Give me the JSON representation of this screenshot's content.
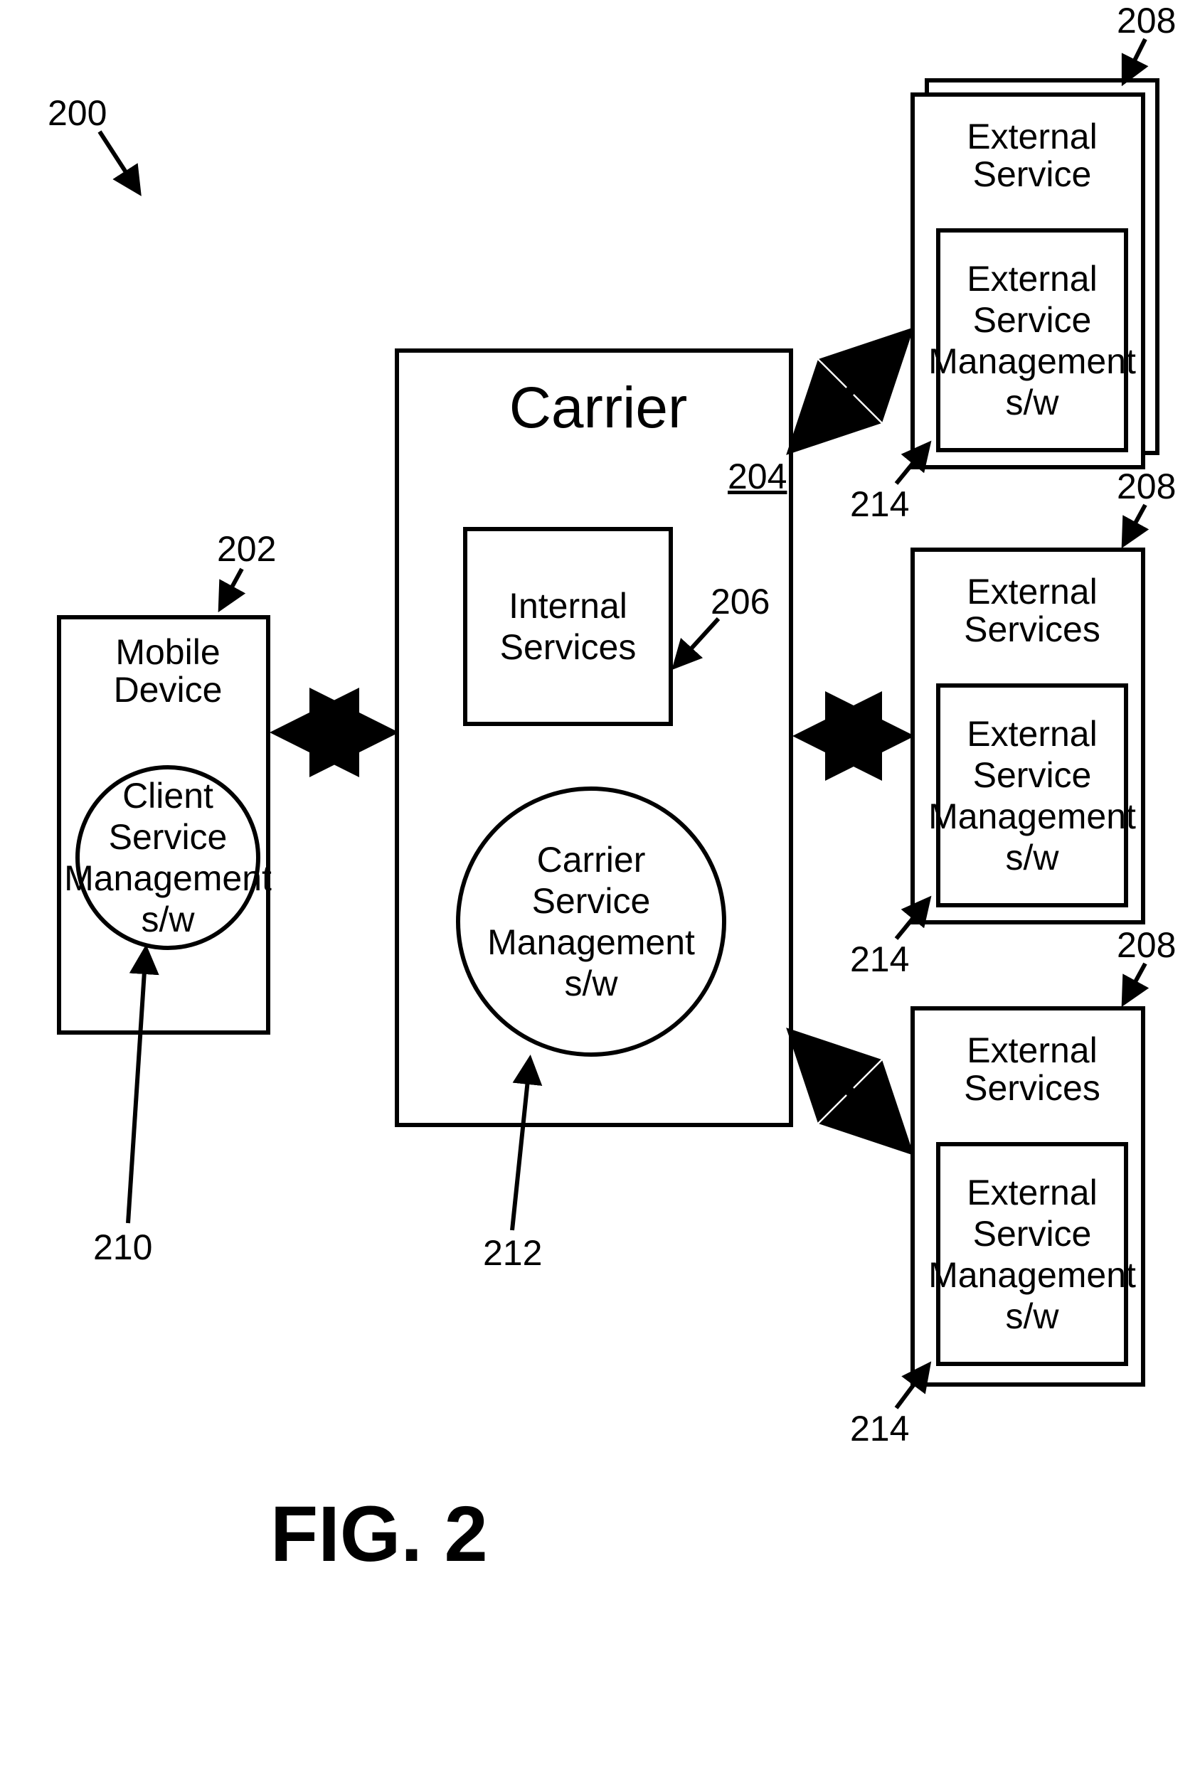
{
  "figure_label": "FIG. 2",
  "refs": {
    "system": "200",
    "mobile_device": "202",
    "carrier": "204",
    "internal_services": "206",
    "ext_a": "208",
    "ext_b": "208",
    "ext_c": "208",
    "client_sw": "210",
    "carrier_sw": "212",
    "ext_sw_a": "214",
    "ext_sw_b": "214",
    "ext_sw_c": "214"
  },
  "mobile_device": {
    "title": "Mobile Device",
    "client_sw": "Client\nService\nManagement\ns/w"
  },
  "carrier": {
    "title": "Carrier",
    "internal_services": "Internal\nServices",
    "carrier_sw": "Carrier\nService\nManagement\ns/w"
  },
  "external": {
    "a": {
      "title": "External\nService",
      "sw": "External\nService\nManagement\ns/w"
    },
    "b": {
      "title": "External\nServices",
      "sw": "External\nService\nManagement\ns/w"
    },
    "c": {
      "title": "External\nServices",
      "sw": "External\nService\nManagement\ns/w"
    }
  },
  "chart_data": {
    "type": "diagram",
    "nodes": [
      {
        "id": "mobile_device",
        "label": "Mobile Device",
        "ref": "202",
        "contains": [
          {
            "id": "client_sw",
            "label": "Client Service Management s/w",
            "ref": "210",
            "shape": "circle"
          }
        ]
      },
      {
        "id": "carrier",
        "label": "Carrier",
        "ref": "204",
        "contains": [
          {
            "id": "internal_services",
            "label": "Internal Services",
            "ref": "206",
            "shape": "rect"
          },
          {
            "id": "carrier_sw",
            "label": "Carrier Service Management s/w",
            "ref": "212",
            "shape": "circle"
          }
        ]
      },
      {
        "id": "ext_a",
        "label": "External Service",
        "ref": "208",
        "contains": [
          {
            "id": "ext_sw_a",
            "label": "External Service Management s/w",
            "ref": "214",
            "shape": "rect"
          }
        ]
      },
      {
        "id": "ext_b",
        "label": "External Services",
        "ref": "208",
        "contains": [
          {
            "id": "ext_sw_b",
            "label": "External Service Management s/w",
            "ref": "214",
            "shape": "rect"
          }
        ]
      },
      {
        "id": "ext_c",
        "label": "External Services",
        "ref": "208",
        "contains": [
          {
            "id": "ext_sw_c",
            "label": "External Service Management s/w",
            "ref": "214",
            "shape": "rect"
          }
        ]
      }
    ],
    "edges": [
      {
        "from": "mobile_device",
        "to": "carrier",
        "bidirectional": true
      },
      {
        "from": "carrier",
        "to": "ext_a",
        "bidirectional": true
      },
      {
        "from": "carrier",
        "to": "ext_b",
        "bidirectional": true
      },
      {
        "from": "carrier",
        "to": "ext_c",
        "bidirectional": true
      }
    ],
    "ref_pointers": [
      {
        "ref": "200",
        "points_to": "system"
      },
      {
        "ref": "202",
        "points_to": "mobile_device"
      },
      {
        "ref": "204",
        "points_to": "carrier"
      },
      {
        "ref": "206",
        "points_to": "internal_services"
      },
      {
        "ref": "210",
        "points_to": "client_sw"
      },
      {
        "ref": "212",
        "points_to": "carrier_sw"
      },
      {
        "ref": "208",
        "points_to": "ext_a"
      },
      {
        "ref": "208",
        "points_to": "ext_b"
      },
      {
        "ref": "208",
        "points_to": "ext_c"
      },
      {
        "ref": "214",
        "points_to": "ext_sw_a"
      },
      {
        "ref": "214",
        "points_to": "ext_sw_b"
      },
      {
        "ref": "214",
        "points_to": "ext_sw_c"
      }
    ]
  }
}
